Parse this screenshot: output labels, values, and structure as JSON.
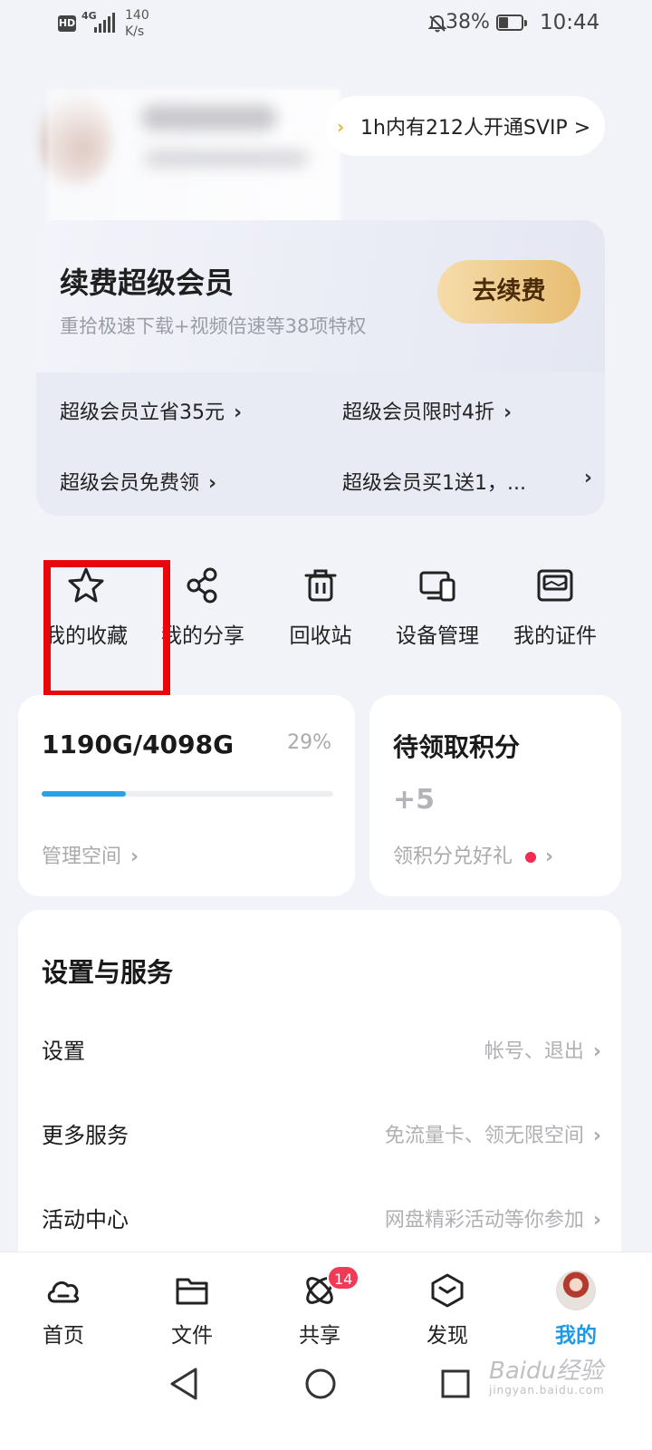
{
  "status_bar": {
    "network": "4G",
    "hd": "HD",
    "speed_value": "140",
    "speed_unit": "K/s",
    "battery": "38%",
    "time": "10:44"
  },
  "profile": {
    "svip_promo": "1h内有212人开通SVIP >"
  },
  "vip_card": {
    "title": "续费超级会员",
    "subtitle": "重拾极速下载+视频倍速等38项特权",
    "renew_button": "去续费",
    "links": [
      "超级会员立省35元",
      "超级会员限时4折",
      "超级会员免费领",
      "超级会员买1送1，..."
    ]
  },
  "quick_actions": [
    {
      "label": "我的收藏",
      "icon": "star-icon"
    },
    {
      "label": "我的分享",
      "icon": "share-icon"
    },
    {
      "label": "回收站",
      "icon": "trash-icon"
    },
    {
      "label": "设备管理",
      "icon": "devices-icon"
    },
    {
      "label": "我的证件",
      "icon": "id-card-icon"
    }
  ],
  "storage": {
    "usage": "1190G/4098G",
    "percent_text": "29%",
    "percent": 29,
    "manage_link": "管理空间"
  },
  "points": {
    "title": "待领取积分",
    "value": "+5",
    "link": "领积分兑好礼"
  },
  "settings": {
    "title": "设置与服务",
    "rows": [
      {
        "label": "设置",
        "hint": "帐号、退出"
      },
      {
        "label": "更多服务",
        "hint": "免流量卡、领无限空间"
      },
      {
        "label": "活动中心",
        "hint": "网盘精彩活动等你参加"
      }
    ]
  },
  "bottom_nav": {
    "items": [
      {
        "label": "首页",
        "icon": "cloud-icon"
      },
      {
        "label": "文件",
        "icon": "folder-icon"
      },
      {
        "label": "共享",
        "icon": "atom-icon",
        "badge": "14"
      },
      {
        "label": "发现",
        "icon": "cube-icon"
      },
      {
        "label": "我的",
        "icon": "avatar",
        "active": true
      }
    ]
  },
  "watermark": {
    "brand": "Baidu经验",
    "url": "jingyan.baidu.com"
  },
  "colors": {
    "accent": "#1d9ae6",
    "highlight": "#e8080c",
    "badge": "#f13b56",
    "gold": "#e7bd72"
  }
}
